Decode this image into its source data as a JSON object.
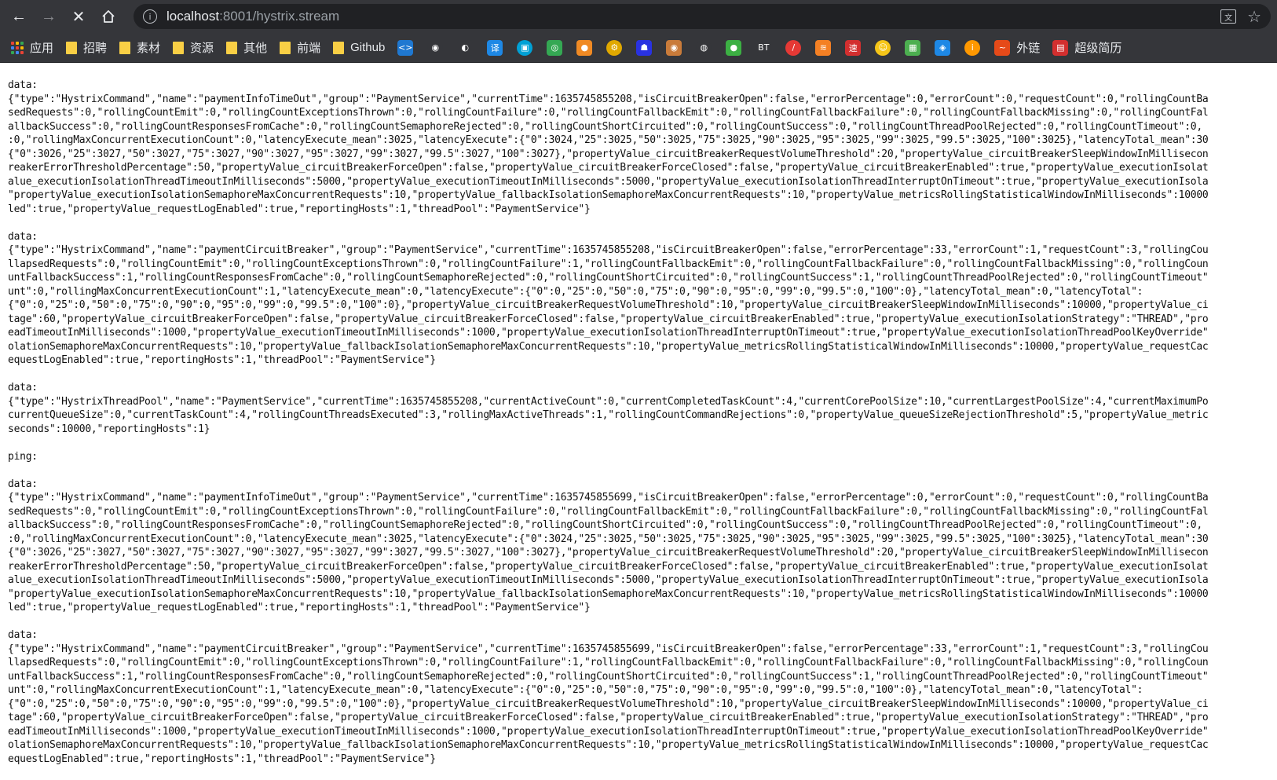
{
  "browser": {
    "url_host": "localhost",
    "url_rest": ":8001/hystrix.stream"
  },
  "bookmarks": [
    {
      "label": "应用",
      "kind": "apps"
    },
    {
      "label": "招聘",
      "kind": "folder"
    },
    {
      "label": "素材",
      "kind": "folder"
    },
    {
      "label": "资源",
      "kind": "folder"
    },
    {
      "label": "其他",
      "kind": "folder"
    },
    {
      "label": "前端",
      "kind": "folder"
    },
    {
      "label": "Github",
      "kind": "folder"
    }
  ],
  "bookmark_icons": [
    {
      "name": "vscode-icon",
      "glyph": "<>",
      "color": "#1f78d1"
    },
    {
      "name": "github-icon",
      "glyph": "◉",
      "color": "#35363a"
    },
    {
      "name": "site-icon-1",
      "glyph": "◐",
      "color": "#35363a"
    },
    {
      "name": "translate-bookmark-icon",
      "glyph": "译",
      "color": "#1e88e5"
    },
    {
      "name": "bilibili-icon",
      "glyph": "▣",
      "color": "#00a1d6"
    },
    {
      "name": "chrome-icon",
      "glyph": "◎",
      "color": "#34a853"
    },
    {
      "name": "basketball-icon",
      "glyph": "●",
      "color": "#f08a24"
    },
    {
      "name": "gear-bookmark-icon",
      "glyph": "⚙",
      "color": "#e0a800"
    },
    {
      "name": "baidu-icon",
      "glyph": "☗",
      "color": "#2932e1"
    },
    {
      "name": "site-icon-2",
      "glyph": "◉",
      "color": "#c97b3a"
    },
    {
      "name": "globe-icon",
      "glyph": "◍",
      "color": "#35363a"
    },
    {
      "name": "site-icon-3",
      "glyph": "●",
      "color": "#3cb043"
    },
    {
      "name": "bt-icon",
      "glyph": "BT",
      "color": "#35363a"
    },
    {
      "name": "pen-icon",
      "glyph": "/",
      "color": "#e53935"
    },
    {
      "name": "stack-icon",
      "glyph": "≋",
      "color": "#f48024"
    },
    {
      "name": "speed-icon",
      "glyph": "速",
      "color": "#d32f2f"
    },
    {
      "name": "face-icon",
      "glyph": "☺",
      "color": "#f5c518"
    },
    {
      "name": "grid-icon",
      "glyph": "▦",
      "color": "#4caf50"
    },
    {
      "name": "site-icon-4",
      "glyph": "◈",
      "color": "#1e88e5"
    },
    {
      "name": "site-icon-5",
      "glyph": "i",
      "color": "#ff9800"
    }
  ],
  "bookmarks_tail": [
    {
      "label": "外链",
      "name": "external-links-bookmark"
    },
    {
      "label": "超级简历",
      "name": "resume-bookmark"
    }
  ],
  "stream_text": "data:\n{\"type\":\"HystrixCommand\",\"name\":\"paymentInfoTimeOut\",\"group\":\"PaymentService\",\"currentTime\":1635745855208,\"isCircuitBreakerOpen\":false,\"errorPercentage\":0,\"errorCount\":0,\"requestCount\":0,\"rollingCountBa\nsedRequests\":0,\"rollingCountEmit\":0,\"rollingCountExceptionsThrown\":0,\"rollingCountFailure\":0,\"rollingCountFallbackEmit\":0,\"rollingCountFallbackFailure\":0,\"rollingCountFallbackMissing\":0,\"rollingCountFal\nallbackSuccess\":0,\"rollingCountResponsesFromCache\":0,\"rollingCountSemaphoreRejected\":0,\"rollingCountShortCircuited\":0,\"rollingCountSuccess\":0,\"rollingCountThreadPoolRejected\":0,\"rollingCountTimeout\":0,\n:0,\"rollingMaxConcurrentExecutionCount\":0,\"latencyExecute_mean\":3025,\"latencyExecute\":{\"0\":3024,\"25\":3025,\"50\":3025,\"75\":3025,\"90\":3025,\"95\":3025,\"99\":3025,\"99.5\":3025,\"100\":3025},\"latencyTotal_mean\":30\n{\"0\":3026,\"25\":3027,\"50\":3027,\"75\":3027,\"90\":3027,\"95\":3027,\"99\":3027,\"99.5\":3027,\"100\":3027},\"propertyValue_circuitBreakerRequestVolumeThreshold\":20,\"propertyValue_circuitBreakerSleepWindowInMillisecon\nreakerErrorThresholdPercentage\":50,\"propertyValue_circuitBreakerForceOpen\":false,\"propertyValue_circuitBreakerForceClosed\":false,\"propertyValue_circuitBreakerEnabled\":true,\"propertyValue_executionIsolat\nalue_executionIsolationThreadTimeoutInMilliseconds\":5000,\"propertyValue_executionTimeoutInMilliseconds\":5000,\"propertyValue_executionIsolationThreadInterruptOnTimeout\":true,\"propertyValue_executionIsola\n\"propertyValue_executionIsolationSemaphoreMaxConcurrentRequests\":10,\"propertyValue_fallbackIsolationSemaphoreMaxConcurrentRequests\":10,\"propertyValue_metricsRollingStatisticalWindowInMilliseconds\":10000\nled\":true,\"propertyValue_requestLogEnabled\":true,\"reportingHosts\":1,\"threadPool\":\"PaymentService\"}\n\ndata:\n{\"type\":\"HystrixCommand\",\"name\":\"paymentCircuitBreaker\",\"group\":\"PaymentService\",\"currentTime\":1635745855208,\"isCircuitBreakerOpen\":false,\"errorPercentage\":33,\"errorCount\":1,\"requestCount\":3,\"rollingCou\nllapsedRequests\":0,\"rollingCountEmit\":0,\"rollingCountExceptionsThrown\":0,\"rollingCountFailure\":1,\"rollingCountFallbackEmit\":0,\"rollingCountFallbackFailure\":0,\"rollingCountFallbackMissing\":0,\"rollingCoun\nuntFallbackSuccess\":1,\"rollingCountResponsesFromCache\":0,\"rollingCountSemaphoreRejected\":0,\"rollingCountShortCircuited\":0,\"rollingCountSuccess\":1,\"rollingCountThreadPoolRejected\":0,\"rollingCountTimeout\"\nunt\":0,\"rollingMaxConcurrentExecutionCount\":1,\"latencyExecute_mean\":0,\"latencyExecute\":{\"0\":0,\"25\":0,\"50\":0,\"75\":0,\"90\":0,\"95\":0,\"99\":0,\"99.5\":0,\"100\":0},\"latencyTotal_mean\":0,\"latencyTotal\":\n{\"0\":0,\"25\":0,\"50\":0,\"75\":0,\"90\":0,\"95\":0,\"99\":0,\"99.5\":0,\"100\":0},\"propertyValue_circuitBreakerRequestVolumeThreshold\":10,\"propertyValue_circuitBreakerSleepWindowInMilliseconds\":10000,\"propertyValue_ci\ntage\":60,\"propertyValue_circuitBreakerForceOpen\":false,\"propertyValue_circuitBreakerForceClosed\":false,\"propertyValue_circuitBreakerEnabled\":true,\"propertyValue_executionIsolationStrategy\":\"THREAD\",\"pro\neadTimeoutInMilliseconds\":1000,\"propertyValue_executionTimeoutInMilliseconds\":1000,\"propertyValue_executionIsolationThreadInterruptOnTimeout\":true,\"propertyValue_executionIsolationThreadPoolKeyOverride\"\nolationSemaphoreMaxConcurrentRequests\":10,\"propertyValue_fallbackIsolationSemaphoreMaxConcurrentRequests\":10,\"propertyValue_metricsRollingStatisticalWindowInMilliseconds\":10000,\"propertyValue_requestCac\nequestLogEnabled\":true,\"reportingHosts\":1,\"threadPool\":\"PaymentService\"}\n\ndata:\n{\"type\":\"HystrixThreadPool\",\"name\":\"PaymentService\",\"currentTime\":1635745855208,\"currentActiveCount\":0,\"currentCompletedTaskCount\":4,\"currentCorePoolSize\":10,\"currentLargestPoolSize\":4,\"currentMaximumPo\ncurrentQueueSize\":0,\"currentTaskCount\":4,\"rollingCountThreadsExecuted\":3,\"rollingMaxActiveThreads\":1,\"rollingCountCommandRejections\":0,\"propertyValue_queueSizeRejectionThreshold\":5,\"propertyValue_metric\nseconds\":10000,\"reportingHosts\":1}\n\nping:\n\ndata:\n{\"type\":\"HystrixCommand\",\"name\":\"paymentInfoTimeOut\",\"group\":\"PaymentService\",\"currentTime\":1635745855699,\"isCircuitBreakerOpen\":false,\"errorPercentage\":0,\"errorCount\":0,\"requestCount\":0,\"rollingCountBa\nsedRequests\":0,\"rollingCountEmit\":0,\"rollingCountExceptionsThrown\":0,\"rollingCountFailure\":0,\"rollingCountFallbackEmit\":0,\"rollingCountFallbackFailure\":0,\"rollingCountFallbackMissing\":0,\"rollingCountFal\nallbackSuccess\":0,\"rollingCountResponsesFromCache\":0,\"rollingCountSemaphoreRejected\":0,\"rollingCountShortCircuited\":0,\"rollingCountSuccess\":0,\"rollingCountThreadPoolRejected\":0,\"rollingCountTimeout\":0,\n:0,\"rollingMaxConcurrentExecutionCount\":0,\"latencyExecute_mean\":3025,\"latencyExecute\":{\"0\":3024,\"25\":3025,\"50\":3025,\"75\":3025,\"90\":3025,\"95\":3025,\"99\":3025,\"99.5\":3025,\"100\":3025},\"latencyTotal_mean\":30\n{\"0\":3026,\"25\":3027,\"50\":3027,\"75\":3027,\"90\":3027,\"95\":3027,\"99\":3027,\"99.5\":3027,\"100\":3027},\"propertyValue_circuitBreakerRequestVolumeThreshold\":20,\"propertyValue_circuitBreakerSleepWindowInMillisecon\nreakerErrorThresholdPercentage\":50,\"propertyValue_circuitBreakerForceOpen\":false,\"propertyValue_circuitBreakerForceClosed\":false,\"propertyValue_circuitBreakerEnabled\":true,\"propertyValue_executionIsolat\nalue_executionIsolationThreadTimeoutInMilliseconds\":5000,\"propertyValue_executionTimeoutInMilliseconds\":5000,\"propertyValue_executionIsolationThreadInterruptOnTimeout\":true,\"propertyValue_executionIsola\n\"propertyValue_executionIsolationSemaphoreMaxConcurrentRequests\":10,\"propertyValue_fallbackIsolationSemaphoreMaxConcurrentRequests\":10,\"propertyValue_metricsRollingStatisticalWindowInMilliseconds\":10000\nled\":true,\"propertyValue_requestLogEnabled\":true,\"reportingHosts\":1,\"threadPool\":\"PaymentService\"}\n\ndata:\n{\"type\":\"HystrixCommand\",\"name\":\"paymentCircuitBreaker\",\"group\":\"PaymentService\",\"currentTime\":1635745855699,\"isCircuitBreakerOpen\":false,\"errorPercentage\":33,\"errorCount\":1,\"requestCount\":3,\"rollingCou\nllapsedRequests\":0,\"rollingCountEmit\":0,\"rollingCountExceptionsThrown\":0,\"rollingCountFailure\":1,\"rollingCountFallbackEmit\":0,\"rollingCountFallbackFailure\":0,\"rollingCountFallbackMissing\":0,\"rollingCoun\nuntFallbackSuccess\":1,\"rollingCountResponsesFromCache\":0,\"rollingCountSemaphoreRejected\":0,\"rollingCountShortCircuited\":0,\"rollingCountSuccess\":1,\"rollingCountThreadPoolRejected\":0,\"rollingCountTimeout\"\nunt\":0,\"rollingMaxConcurrentExecutionCount\":1,\"latencyExecute_mean\":0,\"latencyExecute\":{\"0\":0,\"25\":0,\"50\":0,\"75\":0,\"90\":0,\"95\":0,\"99\":0,\"99.5\":0,\"100\":0},\"latencyTotal_mean\":0,\"latencyTotal\":\n{\"0\":0,\"25\":0,\"50\":0,\"75\":0,\"90\":0,\"95\":0,\"99\":0,\"99.5\":0,\"100\":0},\"propertyValue_circuitBreakerRequestVolumeThreshold\":10,\"propertyValue_circuitBreakerSleepWindowInMilliseconds\":10000,\"propertyValue_ci\ntage\":60,\"propertyValue_circuitBreakerForceOpen\":false,\"propertyValue_circuitBreakerForceClosed\":false,\"propertyValue_circuitBreakerEnabled\":true,\"propertyValue_executionIsolationStrategy\":\"THREAD\",\"pro\neadTimeoutInMilliseconds\":1000,\"propertyValue_executionTimeoutInMilliseconds\":1000,\"propertyValue_executionIsolationThreadInterruptOnTimeout\":true,\"propertyValue_executionIsolationThreadPoolKeyOverride\"\nolationSemaphoreMaxConcurrentRequests\":10,\"propertyValue_fallbackIsolationSemaphoreMaxConcurrentRequests\":10,\"propertyValue_metricsRollingStatisticalWindowInMilliseconds\":10000,\"propertyValue_requestCac\nequestLogEnabled\":true,\"reportingHosts\":1,\"threadPool\":\"PaymentService\"}"
}
